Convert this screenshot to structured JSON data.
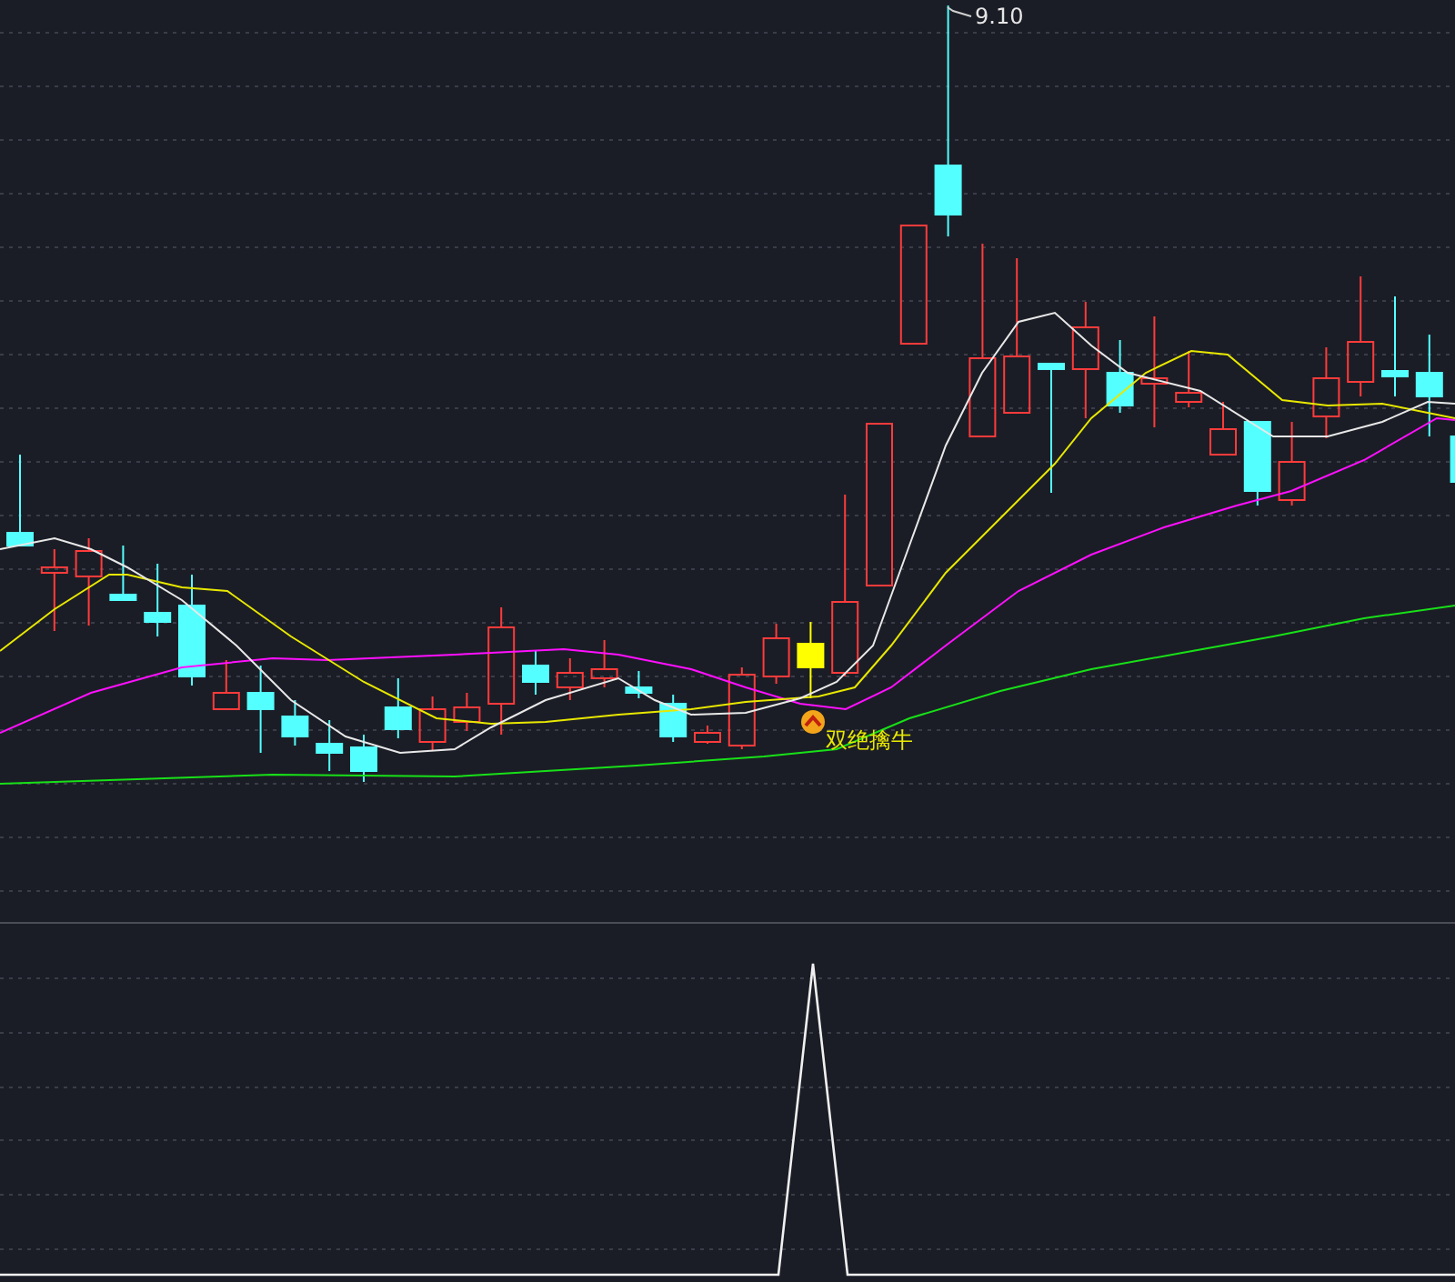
{
  "price_chart": {
    "high_label": "9.10",
    "signal_label": "双绝擒牛"
  }
}
